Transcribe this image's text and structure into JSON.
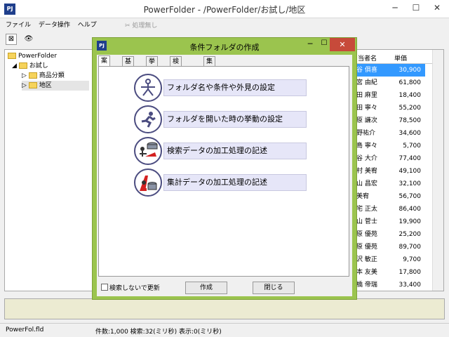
{
  "main": {
    "title": "PowerFolder - /PowerFolder/お試し/地区",
    "logo": "PJ",
    "menu": [
      "ファイル",
      "データ操作",
      "ヘルプ"
    ],
    "toolbar_hint": "処理無し",
    "tree": {
      "root": "PowerFolder",
      "child": "お試し",
      "items": [
        "商品分類",
        "地区"
      ]
    },
    "list": {
      "headers": [
        "当者名",
        "単価"
      ],
      "rows": [
        [
          "谷 俱喜",
          "30,900"
        ],
        [
          "宮 由紀",
          "61,800"
        ],
        [
          "田 麻里",
          "18,400"
        ],
        [
          "田 寧々",
          "55,200"
        ],
        [
          "原 謙次",
          "78,500"
        ],
        [
          "野祐介",
          "34,600"
        ],
        [
          "島 寧々",
          "5,700"
        ],
        [
          "谷 大介",
          "77,400"
        ],
        [
          "村 美宥",
          "49,100"
        ],
        [
          "山 昌宏",
          "32,100"
        ],
        [
          "美宥",
          "56,700"
        ],
        [
          "宅 正太",
          "86,400"
        ],
        [
          "山 菅士",
          "19,900"
        ],
        [
          "原 優苑",
          "25,200"
        ],
        [
          "原 優苑",
          "89,700"
        ],
        [
          "沢 敏正",
          "9,700"
        ],
        [
          "本 友美",
          "17,800"
        ],
        [
          "橋 帝瑞",
          "33,400"
        ]
      ]
    },
    "status": {
      "file": "PowerFol.fld",
      "info": "件数:1,000 検索:32(ミリ秒) 表示:0(ミリ秒)"
    }
  },
  "dialog": {
    "title": "条件フォルダの作成",
    "logo": "PJ",
    "tabs": [
      "案内",
      "基本",
      "挙動",
      "検索処理",
      "集計処理"
    ],
    "options": [
      {
        "label": "フォルダ名や条件や外見の設定",
        "icon": "person-icon"
      },
      {
        "label": "フォルダを開いた時の挙動の設定",
        "icon": "runner-icon"
      },
      {
        "label": "検索データの加工処理の記述",
        "icon": "worker-search-icon"
      },
      {
        "label": "集計データの加工処理の記述",
        "icon": "worker-aggregate-icon"
      }
    ],
    "checkbox_label": "検索しないで更新",
    "create_button": "作成",
    "close_button": "閉じる"
  }
}
